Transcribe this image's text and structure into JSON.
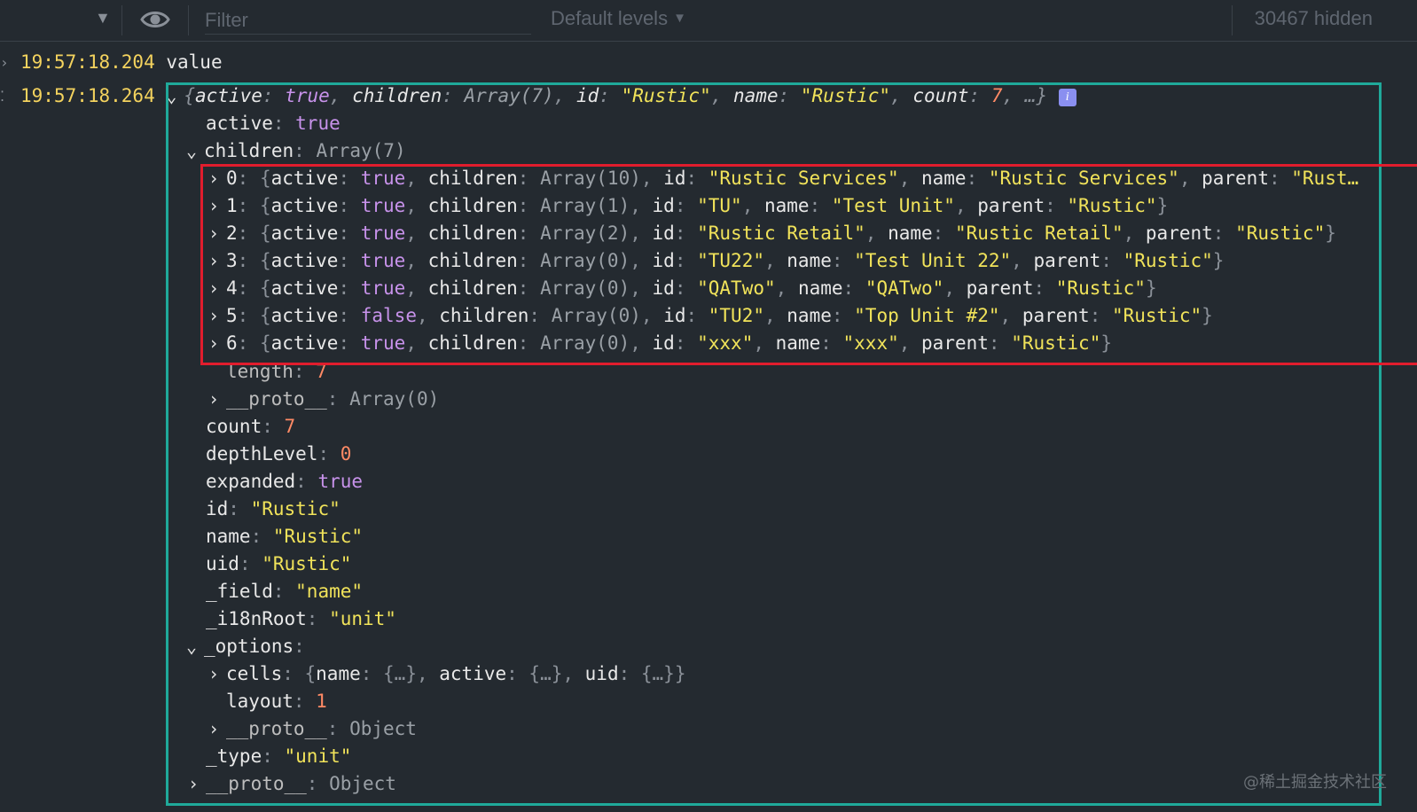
{
  "toolbar": {
    "filter_placeholder": "Filter",
    "levels_label": "Default levels",
    "hidden_count": "30467 hidden"
  },
  "log1": {
    "time": "19:57:18.204",
    "text": "value"
  },
  "log2": {
    "time": "19:57:18.264"
  },
  "summary": {
    "open": "{",
    "k_active": "active",
    "v_active": "true",
    "k_children": "children",
    "v_children": "Array(7)",
    "k_id": "id",
    "v_id": "\"Rustic\"",
    "k_name": "name",
    "v_name": "\"Rustic\"",
    "k_count": "count",
    "v_count": "7",
    "tail": ", …}",
    "info_label": "i"
  },
  "props": {
    "active": {
      "key": "active",
      "value": "true"
    },
    "children": {
      "key": "children",
      "value": "Array(7)"
    }
  },
  "children": [
    {
      "index": "0",
      "active": "true",
      "children": "Array(10)",
      "id": "\"Rustic Services\"",
      "name": "\"Rustic Services\"",
      "parent": "\"Rust…"
    },
    {
      "index": "1",
      "active": "true",
      "children": "Array(1)",
      "id": "\"TU\"",
      "name": "\"Test Unit\"",
      "parent": "\"Rustic\""
    },
    {
      "index": "2",
      "active": "true",
      "children": "Array(2)",
      "id": "\"Rustic Retail\"",
      "name": "\"Rustic Retail\"",
      "parent": "\"Rustic\""
    },
    {
      "index": "3",
      "active": "true",
      "children": "Array(0)",
      "id": "\"TU22\"",
      "name": "\"Test Unit 22\"",
      "parent": "\"Rustic\""
    },
    {
      "index": "4",
      "active": "true",
      "children": "Array(0)",
      "id": "\"QATwo\"",
      "name": "\"QATwo\"",
      "parent": "\"Rustic\""
    },
    {
      "index": "5",
      "active": "false",
      "children": "Array(0)",
      "id": "\"TU2\"",
      "name": "\"Top Unit #2\"",
      "parent": "\"Rustic\""
    },
    {
      "index": "6",
      "active": "true",
      "children": "Array(0)",
      "id": "\"xxx\"",
      "name": "\"xxx\"",
      "parent": "\"Rustic\""
    }
  ],
  "children_labels": {
    "active": "active",
    "children": "children",
    "id": "id",
    "name": "name",
    "parent": "parent"
  },
  "length": {
    "key": "length",
    "value": "7"
  },
  "proto_array": {
    "key": "__proto__",
    "value": "Array(0)"
  },
  "fields": [
    {
      "key": "count",
      "value": "7",
      "kind": "num"
    },
    {
      "key": "depthLevel",
      "value": "0",
      "kind": "num"
    },
    {
      "key": "expanded",
      "value": "true",
      "kind": "bool"
    },
    {
      "key": "id",
      "value": "\"Rustic\"",
      "kind": "str"
    },
    {
      "key": "name",
      "value": "\"Rustic\"",
      "kind": "str"
    },
    {
      "key": "uid",
      "value": "\"Rustic\"",
      "kind": "str"
    },
    {
      "key": "_field",
      "value": "\"name\"",
      "kind": "str"
    },
    {
      "key": "_i18nRoot",
      "value": "\"unit\"",
      "kind": "str"
    }
  ],
  "options": {
    "key": "_options",
    "cells": {
      "key": "cells",
      "k_name": "name",
      "k_active": "active",
      "k_uid": "uid",
      "collapsed": "{…}"
    },
    "layout": {
      "key": "layout",
      "value": "1"
    },
    "proto": {
      "key": "__proto__",
      "value": "Object"
    }
  },
  "type_field": {
    "key": "_type",
    "value": "\"unit\""
  },
  "proto_object": {
    "key": "__proto__",
    "value": "Object"
  },
  "watermark": "@稀土掘金技术社区"
}
